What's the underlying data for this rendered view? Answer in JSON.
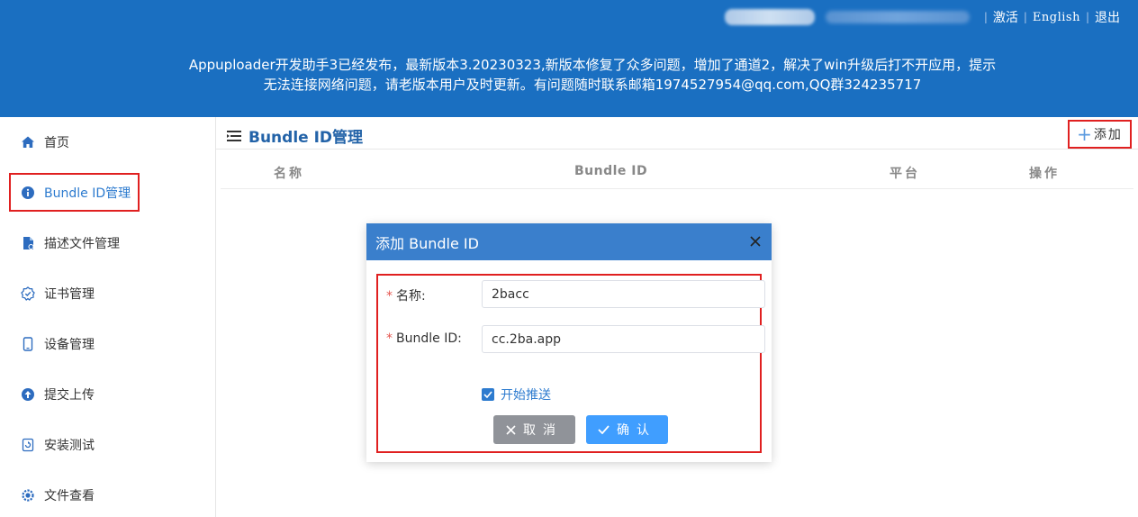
{
  "header": {
    "links": {
      "activate": "激活",
      "english": "English",
      "logout": "退出"
    },
    "notice_line1": "Appuploader开发助手3已经发布，最新版本3.20230323,新版本修复了众多问题，增加了通道2，解决了win升级后打不开应用，提示",
    "notice_line2": "无法连接网络问题，请老版本用户及时更新。有问题随时联系邮箱1974527954@qq.com,QQ群324235717"
  },
  "sidebar": {
    "items": [
      {
        "label": "首页",
        "icon": "home-icon"
      },
      {
        "label": "Bundle ID管理",
        "icon": "info-icon"
      },
      {
        "label": "描述文件管理",
        "icon": "file-icon"
      },
      {
        "label": "证书管理",
        "icon": "certificate-icon"
      },
      {
        "label": "设备管理",
        "icon": "phone-icon"
      },
      {
        "label": "提交上传",
        "icon": "upload-icon"
      },
      {
        "label": "安装测试",
        "icon": "install-icon"
      },
      {
        "label": "文件查看",
        "icon": "gear-icon"
      }
    ],
    "active_index": 1
  },
  "main": {
    "title": "Bundle ID管理",
    "add_label": "添加",
    "columns": [
      "名称",
      "Bundle ID",
      "平台",
      "操作"
    ]
  },
  "dialog": {
    "title": "添加 Bundle ID",
    "name_label": "名称:",
    "name_value": "2bacc",
    "bundle_label": "Bundle ID:",
    "bundle_value": "cc.2ba.app",
    "push_label": "开始推送",
    "push_checked": true,
    "cancel_label": "取消",
    "confirm_label": "确认"
  },
  "colors": {
    "header_bg": "#1a6fc1",
    "accent": "#2d7bcf",
    "highlight_border": "#e02020",
    "confirm_button": "#409eff",
    "cancel_button": "#909399"
  }
}
